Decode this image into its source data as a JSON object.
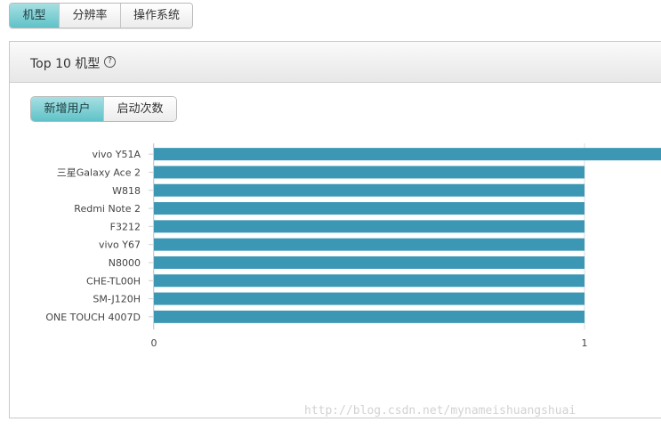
{
  "top_tabs": {
    "items": [
      {
        "label": "机型",
        "active": true
      },
      {
        "label": "分辨率",
        "active": false
      },
      {
        "label": "操作系统",
        "active": false
      }
    ]
  },
  "panel": {
    "title": "Top 10 机型",
    "help_icon": "?",
    "sub_tabs": [
      {
        "label": "新增用户",
        "active": true
      },
      {
        "label": "启动次数",
        "active": false
      }
    ]
  },
  "colors": {
    "accent": "#5fc2c8",
    "bar": "#3c97b4"
  },
  "chart_data": {
    "type": "bar",
    "orientation": "horizontal",
    "categories": [
      "vivo Y51A",
      "三星Galaxy Ace 2",
      "W818",
      "Redmi Note 2",
      "F3212",
      "vivo Y67",
      "N8000",
      "CHE-TL00H",
      "SM-J120H",
      "ONE TOUCH 4007D"
    ],
    "values": [
      1.2,
      1,
      1,
      1,
      1,
      1,
      1,
      1,
      1,
      1
    ],
    "x_ticks": [
      "0",
      "1"
    ],
    "xlim": [
      0,
      1
    ],
    "grid": true
  },
  "watermark": "http://blog.csdn.net/mynameishuangshuai"
}
